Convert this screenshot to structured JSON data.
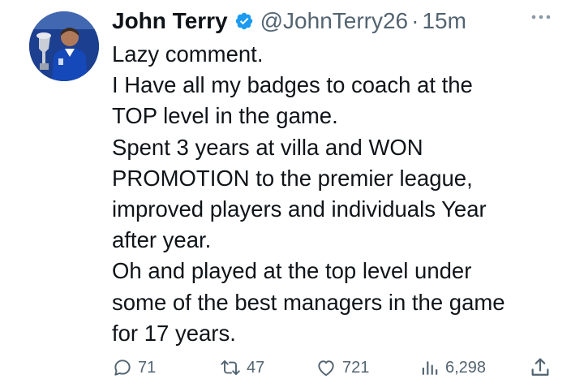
{
  "tweet": {
    "author_name": "John Terry",
    "handle": "@JohnTerry26",
    "separator": "·",
    "time": "15m",
    "more_icon": "more-horizontal-icon",
    "verified_icon": "verified-badge-icon",
    "lines": [
      "Lazy comment.",
      "I Have all my badges to coach at the",
      "TOP level in the game.",
      "Spent 3 years at villa and WON",
      "PROMOTION to the premier league,",
      "improved players and individuals Year",
      "after year.",
      "Oh and played at the top level under",
      "some of the best managers in the game",
      "for 17 years."
    ]
  },
  "actions": {
    "replies": "71",
    "reposts": "47",
    "likes": "721",
    "views": "6,298",
    "icons": [
      "reply-icon",
      "repost-icon",
      "like-icon",
      "views-icon",
      "share-icon"
    ]
  },
  "colors": {
    "text": "#0f1419",
    "secondary": "#536471",
    "verified": "#1d9bf0",
    "background": "#ffffff"
  }
}
